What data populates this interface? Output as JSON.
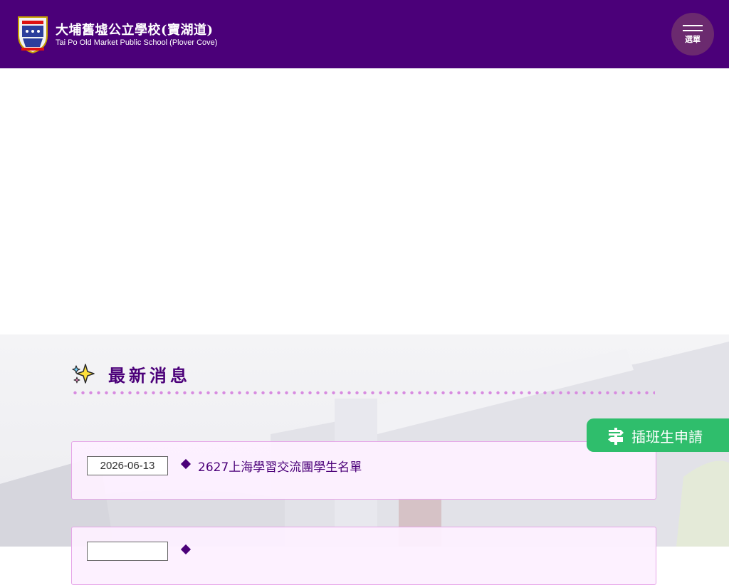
{
  "header": {
    "school_name_zh": "大埔舊墟公立學校(寶湖道)",
    "school_name_en": "Tai Po Old Market Public School (Plover Cove)",
    "menu_label": "選單"
  },
  "news": {
    "title": "最新消息",
    "items": [
      {
        "date": "2026-06-13",
        "title": "2627上海學習交流團學生名單"
      },
      {
        "date": "",
        "title": ""
      }
    ]
  },
  "apply": {
    "label": "插班生申請"
  },
  "colors": {
    "header": "#4b0079",
    "accent": "#4b0079",
    "dots": "#d88ce0",
    "apply": "#2fbe6c"
  },
  "icons": [
    "school-crest-icon",
    "hamburger-menu-icon",
    "sparkle-icon",
    "diamond-bullet-icon",
    "signpost-icon"
  ]
}
